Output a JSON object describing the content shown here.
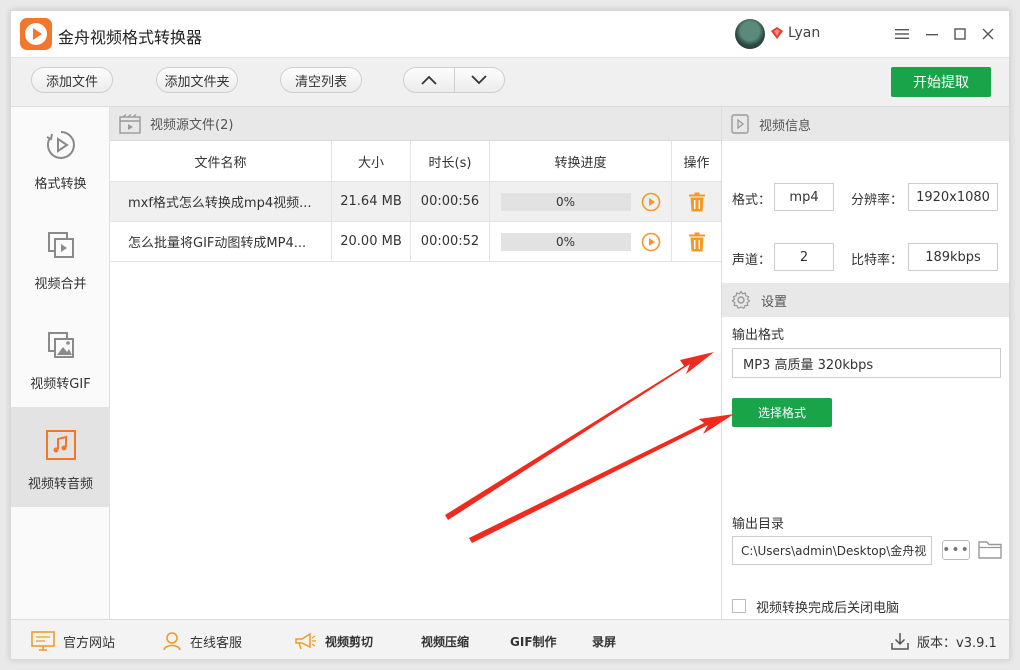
{
  "app": {
    "title": "金舟视频格式转换器",
    "user": {
      "name": "Lyan"
    }
  },
  "toolbar": {
    "add_file": "添加文件",
    "add_folder": "添加文件夹",
    "clear_list": "清空列表",
    "move_up": "︿",
    "move_down": "﹀",
    "start": "开始提取"
  },
  "sidebar": {
    "items": [
      {
        "label": "格式转换",
        "icon": "format-convert-icon"
      },
      {
        "label": "视频合并",
        "icon": "video-merge-icon"
      },
      {
        "label": "视频转GIF",
        "icon": "video-to-gif-icon"
      },
      {
        "label": "视频转音频",
        "icon": "video-to-audio-icon",
        "active": true
      }
    ]
  },
  "source": {
    "header": "视频源文件(2)",
    "columns": {
      "name": "文件名称",
      "size": "大小",
      "duration": "时长(s)",
      "progress": "转换进度",
      "op": "操作"
    },
    "rows": [
      {
        "name": "mxf格式怎么转换成mp4视频...",
        "size": "21.64 MB",
        "duration": "00:00:56",
        "progress": "0%",
        "selected": true
      },
      {
        "name": "怎么批量将GIF动图转成MP4...",
        "size": "20.00 MB",
        "duration": "00:00:52",
        "progress": "0%",
        "selected": false
      }
    ]
  },
  "video_info": {
    "header": "视频信息",
    "format_label": "格式：",
    "format_value": "mp4",
    "resolution_label": "分辨率：",
    "resolution_value": "1920x1080",
    "channels_label": "声道：",
    "channels_value": "2",
    "bitrate_label": "比特率：",
    "bitrate_value": "189kbps"
  },
  "settings": {
    "header": "设置",
    "output_format_label": "输出格式",
    "output_format_value": "MP3 高质量 320kbps",
    "select_format": "选择格式",
    "output_dir_label": "输出目录",
    "output_dir_value": "C:\\Users\\admin\\Desktop\\金舟视",
    "more": "•••",
    "shutdown_label": "视频转换完成后关闭电脑"
  },
  "bottom": {
    "official_site": "官方网站",
    "online_service": "在线客服",
    "video_cut": "视频剪切",
    "video_compress": "视频压缩",
    "gif_make": "GIF制作",
    "screen_record": "录屏",
    "version": "版本：v3.9.1"
  },
  "colors": {
    "accent_green": "#1aa44a",
    "accent_orange": "#f2762b",
    "annotation_red": "#f02a1e"
  }
}
